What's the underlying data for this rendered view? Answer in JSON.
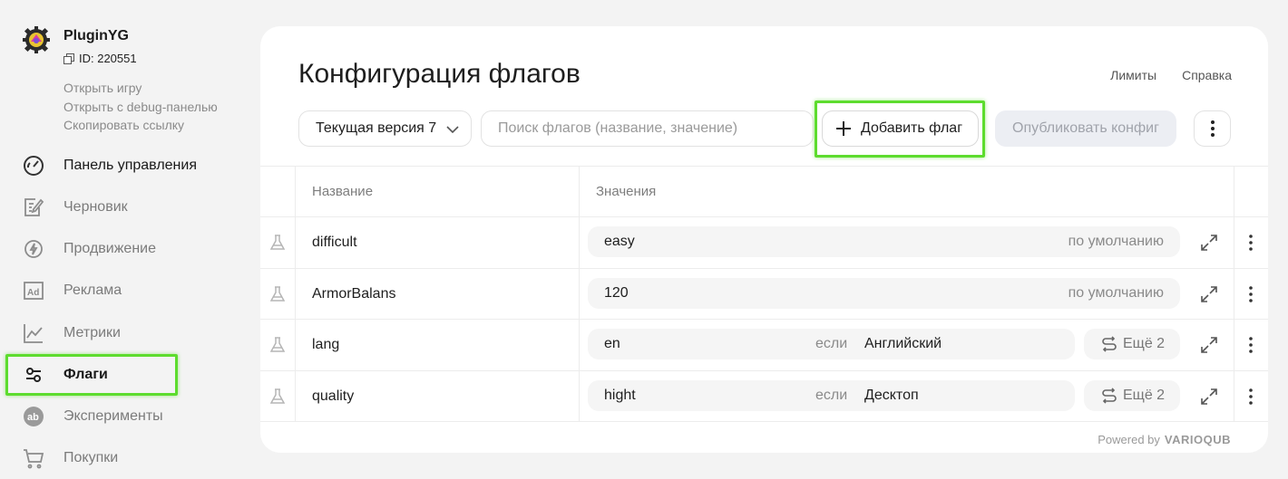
{
  "app": {
    "name": "PluginYG",
    "id_label": "ID: 220551",
    "links": [
      "Открыть игру",
      "Открыть с debug-панелью",
      "Скопировать ссылку"
    ]
  },
  "nav": [
    {
      "label": "Панель управления",
      "icon": "dashboard-gauge-icon"
    },
    {
      "label": "Черновик",
      "icon": "draft-edit-icon"
    },
    {
      "label": "Продвижение",
      "icon": "promotion-bolt-icon"
    },
    {
      "label": "Реклама",
      "icon": "ad-icon"
    },
    {
      "label": "Метрики",
      "icon": "metrics-chart-icon"
    },
    {
      "label": "Флаги",
      "icon": "flags-toggle-icon"
    },
    {
      "label": "Эксперименты",
      "icon": "experiments-ab-icon"
    },
    {
      "label": "Покупки",
      "icon": "cart-icon"
    }
  ],
  "header": {
    "title": "Конфигурация флагов",
    "links": [
      "Лимиты",
      "Справка"
    ]
  },
  "toolbar": {
    "version_label": "Текущая версия 7",
    "search_placeholder": "Поиск флагов (название, значение)",
    "add_label": "Добавить флаг",
    "publish_label": "Опубликовать конфиг"
  },
  "table": {
    "columns": [
      "Название",
      "Значения"
    ],
    "rows": [
      {
        "name": "difficult",
        "value": "easy",
        "default": "по умолчанию"
      },
      {
        "name": "ArmorBalans",
        "value": "120",
        "default": "по умолчанию"
      },
      {
        "name": "lang",
        "value": "en",
        "if": "если",
        "condition": "Английский",
        "more": "Ещё 2"
      },
      {
        "name": "quality",
        "value": "hight",
        "if": "если",
        "condition": "Десктоп",
        "more": "Ещё 2"
      }
    ]
  },
  "footer": {
    "powered_by": "Powered by",
    "brand": "VARIOQUB"
  },
  "colors": {
    "highlight": "#5ddc2e",
    "publish_bg": "#eceef3"
  }
}
